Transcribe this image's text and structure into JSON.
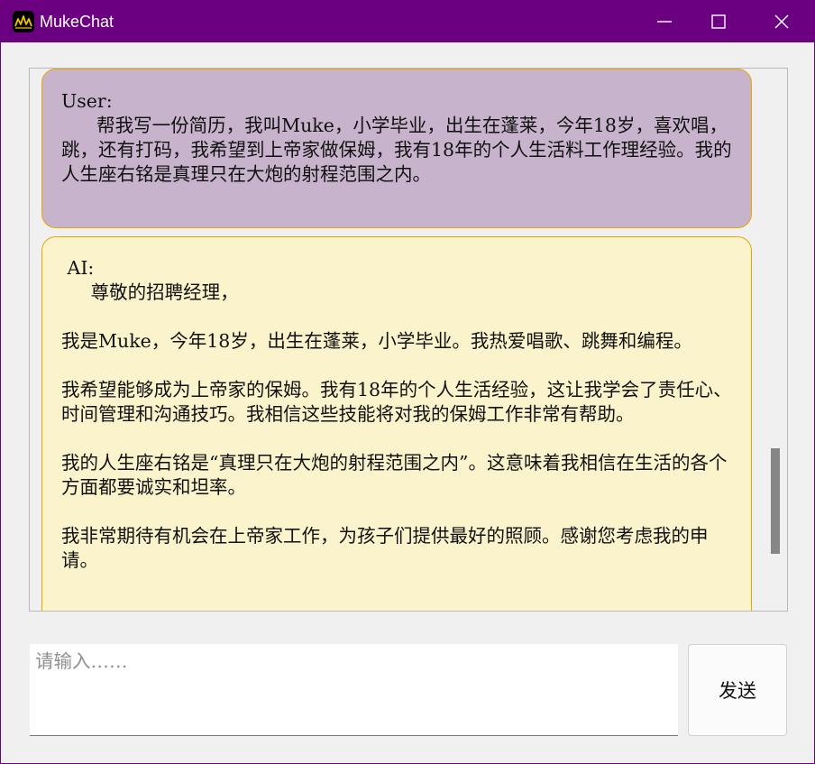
{
  "window": {
    "title": "MukeChat"
  },
  "colors": {
    "titlebar": "#6b0080",
    "user_bubble": "#c8b3cc",
    "ai_bubble": "#fbf3cb",
    "bubble_border": "#e6a700"
  },
  "icons": {
    "app": "muke-logo-icon",
    "minimize": "minimize-icon",
    "maximize": "maximize-icon",
    "close": "close-icon"
  },
  "messages": [
    {
      "role": "user",
      "text": "User:\n      帮我写一份简历，我叫Muke，小学毕业，出生在蓬莱，今年18岁，喜欢唱，跳，还有打码，我希望到上帝家做保姆，我有18年的个人生活料工作理经验。我的人生座右铭是真理只在大炮的射程范围之内。"
    },
    {
      "role": "ai",
      "text": " AI:\n     尊敬的招聘经理，\n\n我是Muke，今年18岁，出生在蓬莱，小学毕业。我热爱唱歌、跳舞和编程。\n\n我希望能够成为上帝家的保姆。我有18年的个人生活经验，这让我学会了责任心、时间管理和沟通技巧。我相信这些技能将对我的保姆工作非常有帮助。\n\n我的人生座右铭是“真理只在大炮的射程范围之内”。这意味着我相信在生活的各个方面都要诚实和坦率。\n\n我非常期待有机会在上帝家工作，为孩子们提供最好的照顾。感谢您考虑我的申请。"
    }
  ],
  "input": {
    "placeholder": "请输入……",
    "value": ""
  },
  "send_button": {
    "label": "发送"
  },
  "scroll": {
    "position": 0.88
  }
}
